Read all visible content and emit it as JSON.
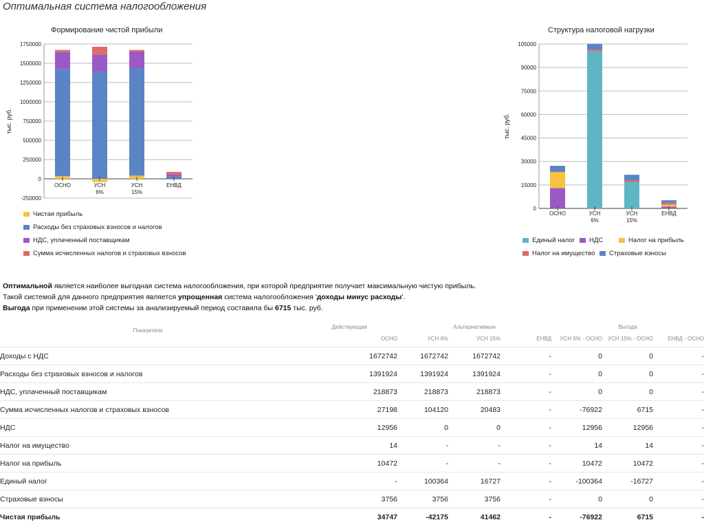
{
  "page": {
    "title": "Оптимальная система налогообложения"
  },
  "chart_data": [
    {
      "type": "bar",
      "stacked": true,
      "title": "Формирование чистой прибыли",
      "ylabel": "тыс. руб.",
      "ylim": [
        -250000,
        1750000
      ],
      "yticks": [
        -250000,
        0,
        250000,
        500000,
        750000,
        1000000,
        1250000,
        1500000,
        1750000
      ],
      "categories": [
        [
          "ОСНО"
        ],
        [
          "УСН",
          "6%"
        ],
        [
          "УСН",
          "15%"
        ],
        [
          "ЕНВД"
        ]
      ],
      "legend_position": "bottom",
      "grid": true,
      "series": [
        {
          "name": "Чистая прибыль",
          "color": "#f5c242",
          "values": [
            34747,
            -42175,
            41462,
            0
          ]
        },
        {
          "name": "Расходы без страховых взносов и налогов",
          "color": "#5b84c4",
          "values": [
            1391924,
            1391924,
            1391924,
            30000
          ]
        },
        {
          "name": "НДС, уплаченный поставщикам",
          "color": "#9b59c6",
          "values": [
            218873,
            218873,
            218873,
            30000
          ]
        },
        {
          "name": "Сумма исчисленных налогов и страховых взносов",
          "color": "#e06b6b",
          "values": [
            27198,
            104120,
            20483,
            30000
          ]
        }
      ]
    },
    {
      "type": "bar",
      "stacked": true,
      "title": "Структура налоговой нагрузки",
      "ylabel": "тыс. руб.",
      "ylim": [
        0,
        105000
      ],
      "yticks": [
        0,
        15000,
        30000,
        45000,
        60000,
        75000,
        90000,
        105000
      ],
      "categories": [
        [
          "ОСНО"
        ],
        [
          "УСН",
          "6%"
        ],
        [
          "УСН",
          "15%"
        ],
        [
          "ЕНВД"
        ]
      ],
      "legend_position": "bottom",
      "grid": true,
      "series": [
        {
          "name": "Единый налог",
          "color": "#5fb5c4",
          "values": [
            0,
            100364,
            16727,
            0
          ]
        },
        {
          "name": "НДС",
          "color": "#9b59c6",
          "values": [
            12956,
            0,
            0,
            1200
          ]
        },
        {
          "name": "Налог на прибыль",
          "color": "#f5c242",
          "values": [
            10472,
            0,
            0,
            1200
          ]
        },
        {
          "name": "Налог на имущество",
          "color": "#e06b6b",
          "values": [
            14,
            1000,
            1000,
            1200
          ]
        },
        {
          "name": "Страховые взносы",
          "color": "#5b84c4",
          "values": [
            3756,
            3756,
            3756,
            1600
          ]
        }
      ]
    }
  ],
  "summary": {
    "line1_bold": "Оптимальной",
    "line1_rest": " является наиболее выгодная система налогообложения, при которой предприятие получает максимальную чистую прибыль.",
    "line2_pre": "Такой системой для данного предприятия является ",
    "line2_bold1": "упрощенная",
    "line2_mid": " система налогообложения '",
    "line2_bold2": "доходы минус расходы",
    "line2_end": "'.",
    "line3_bold": "Выгода",
    "line3_mid": " при применении этой системы за анализируемый период составила бы ",
    "line3_value": "6715",
    "line3_end": " тыс. руб."
  },
  "table": {
    "col_indicators": "Показатели",
    "group_current": "Действующая",
    "group_alt": "Альтернативные",
    "group_benefit": "Выгода",
    "columns": [
      "ОСНО",
      "УСН 6%",
      "УСН 15%",
      "ЕНВД",
      "УСН 6% - ОСНО",
      "УСН 15% - ОСНО",
      "ЕНВД - ОСНО"
    ],
    "rows": [
      {
        "label": "Доходы с НДС",
        "values": [
          "1672742",
          "1672742",
          "1672742",
          "-",
          "0",
          "0",
          "-"
        ]
      },
      {
        "label": "Расходы без страховых взносов и налогов",
        "values": [
          "1391924",
          "1391924",
          "1391924",
          "-",
          "0",
          "0",
          "-"
        ]
      },
      {
        "label": "НДС, уплаченный поставщикам",
        "values": [
          "218873",
          "218873",
          "218873",
          "-",
          "0",
          "0",
          "-"
        ]
      },
      {
        "label": "Сумма исчисленных налогов и страховых взносов",
        "values": [
          "27198",
          "104120",
          "20483",
          "-",
          "-76922",
          "6715",
          "-"
        ]
      },
      {
        "label": "НДС",
        "indent": true,
        "values": [
          "12956",
          "0",
          "0",
          "-",
          "12956",
          "12956",
          "-"
        ]
      },
      {
        "label": "Налог на имущество",
        "indent": true,
        "values": [
          "14",
          "-",
          "-",
          "-",
          "14",
          "14",
          "-"
        ]
      },
      {
        "label": "Налог на прибыль",
        "indent": true,
        "values": [
          "10472",
          "-",
          "-",
          "-",
          "10472",
          "10472",
          "-"
        ]
      },
      {
        "label": "Единый налог",
        "indent": true,
        "values": [
          "-",
          "100364",
          "16727",
          "-",
          "-100364",
          "-16727",
          "-"
        ]
      },
      {
        "label": "Страховые взносы",
        "indent": true,
        "values": [
          "3756",
          "3756",
          "3756",
          "-",
          "0",
          "0",
          "-"
        ]
      },
      {
        "label": "Чистая прибыль",
        "bold": true,
        "values": [
          "34747",
          "-42175",
          "41462",
          "-",
          "-76922",
          "6715",
          "-"
        ]
      }
    ]
  }
}
